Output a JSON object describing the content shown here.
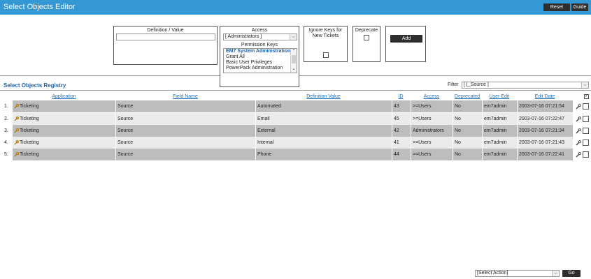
{
  "header": {
    "title": "Select Objects Editor",
    "reset_label": "Reset",
    "guide_label": "Guide"
  },
  "form": {
    "definition_label": "Definition / Value",
    "definition_value": "",
    "access_label": "Access",
    "access_value": "[ Administrators ]",
    "permission_keys_label": "Permission Keys",
    "permission_keys": [
      "EM7 System Administration",
      "Grant All",
      "Basic User Privileges",
      "PowerPack Administration"
    ],
    "ignore_keys_label": "Ignore Keys for New Tickets",
    "deprecate_label": "Deprecate",
    "add_label": "Add"
  },
  "registry": {
    "title": "Select Objects Registry",
    "filter_label": "Filter",
    "filter_value": "[ [_Source ]",
    "columns": [
      "Application",
      "Field Name",
      "Definition Value",
      "ID",
      "Access",
      "Deprecated",
      "User Edit",
      "Edit Date"
    ],
    "rows": [
      {
        "num": "1.",
        "application": "Ticketing",
        "field": "Source",
        "value": "Automated",
        "id": "43",
        "access": ">=Users",
        "deprecated": "No",
        "user": "em7admin",
        "date": "2003-07-16 07:21:54"
      },
      {
        "num": "2.",
        "application": "Ticketing",
        "field": "Source",
        "value": "Email",
        "id": "45",
        "access": ">=Users",
        "deprecated": "No",
        "user": "em7admin",
        "date": "2003-07-16 07:22:47"
      },
      {
        "num": "3.",
        "application": "Ticketing",
        "field": "Source",
        "value": "External",
        "id": "42",
        "access": "Administrators",
        "deprecated": "No",
        "user": "em7admin",
        "date": "2003-07-16 07:21:34"
      },
      {
        "num": "4.",
        "application": "Ticketing",
        "field": "Source",
        "value": "Internal",
        "id": "41",
        "access": ">=Users",
        "deprecated": "No",
        "user": "em7admin",
        "date": "2003-07-16 07:21:43"
      },
      {
        "num": "5.",
        "application": "Ticketing",
        "field": "Source",
        "value": "Phone",
        "id": "44",
        "access": ">=Users",
        "deprecated": "No",
        "user": "em7admin",
        "date": "2003-07-16 07:22:41"
      }
    ]
  },
  "footer": {
    "action_value": "[Select Action]",
    "go_label": "Go"
  },
  "colors": {
    "title_bar": "#3498d4",
    "button": "#2e2e2e",
    "link": "#1f6fb8",
    "row_dark": "#bdbdbd",
    "row_light": "#ebebeb"
  },
  "icons": {
    "row_icon": "key-icon",
    "edit_icon": "wrench-icon"
  }
}
